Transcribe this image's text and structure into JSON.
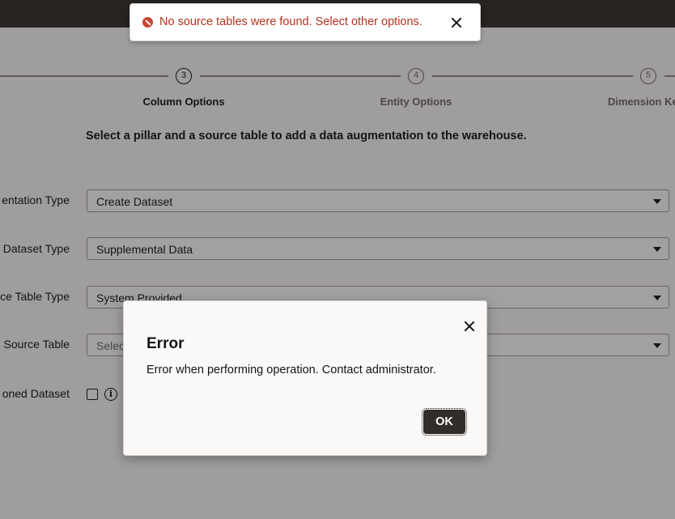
{
  "train": {
    "steps": [
      {
        "number": "3",
        "label": "Column Options"
      },
      {
        "number": "4",
        "label": "Entity Options"
      },
      {
        "number": "5",
        "label": "Dimension Ke"
      }
    ]
  },
  "form": {
    "intro": "Select a pillar and a source table to add a data augmentation to the warehouse.",
    "rows": [
      {
        "label": "entation Type",
        "value": "Create Dataset"
      },
      {
        "label": "Dataset Type",
        "value": "Supplemental Data"
      },
      {
        "label": "ce Table Type",
        "value": "System Provided"
      },
      {
        "label": "Source Table",
        "placeholder": "Selec"
      }
    ],
    "checkbox_label": "oned Dataset",
    "info_glyph": "i"
  },
  "toast": {
    "message": "No source tables were found. Select other options.",
    "icon": "error-icon"
  },
  "dialog": {
    "title": "Error",
    "body": "Error when performing operation. Contact administrator.",
    "ok_label": "OK"
  }
}
